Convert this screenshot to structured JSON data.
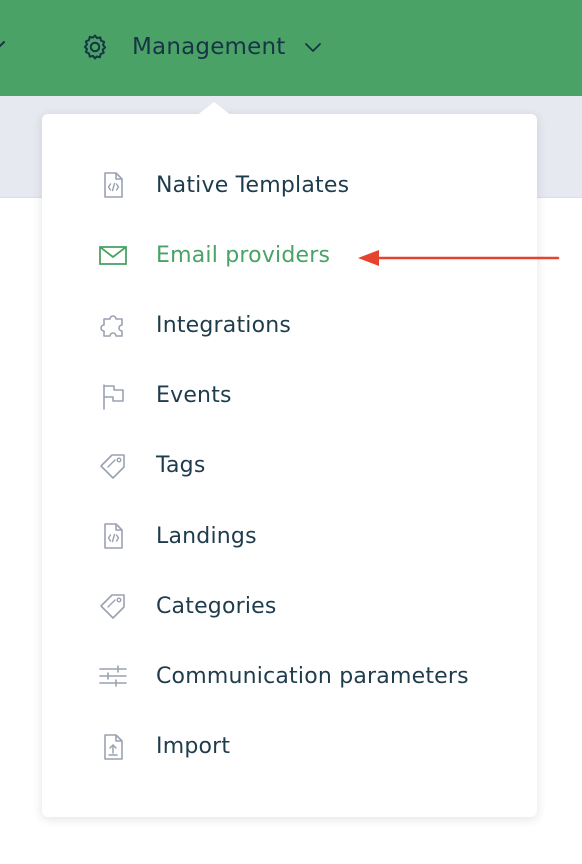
{
  "colors": {
    "topbar": "#4aa266",
    "accent": "#4aa266",
    "text": "#1f3c4d",
    "icon": "#9aa2b1",
    "annotation": "#e5432d",
    "subbar": "#e7e9f0"
  },
  "header": {
    "menu_label": "Management",
    "menu_icon": "gear-icon",
    "dropdown_indicator": "chevron-down-icon"
  },
  "dropdown": {
    "items": [
      {
        "label": "Native Templates",
        "icon": "code-file-icon",
        "active": false
      },
      {
        "label": "Email providers",
        "icon": "envelope-icon",
        "active": true
      },
      {
        "label": "Integrations",
        "icon": "puzzle-icon",
        "active": false
      },
      {
        "label": "Events",
        "icon": "flag-icon",
        "active": false
      },
      {
        "label": "Tags",
        "icon": "tag-icon",
        "active": false
      },
      {
        "label": "Landings",
        "icon": "code-file-icon",
        "active": false
      },
      {
        "label": "Categories",
        "icon": "tag-icon",
        "active": false
      },
      {
        "label": "Communication parameters",
        "icon": "sliders-icon",
        "active": false
      },
      {
        "label": "Import",
        "icon": "file-upload-icon",
        "active": false
      }
    ]
  },
  "annotation": {
    "type": "arrow",
    "points_to": "Email providers",
    "color": "#e5432d"
  }
}
